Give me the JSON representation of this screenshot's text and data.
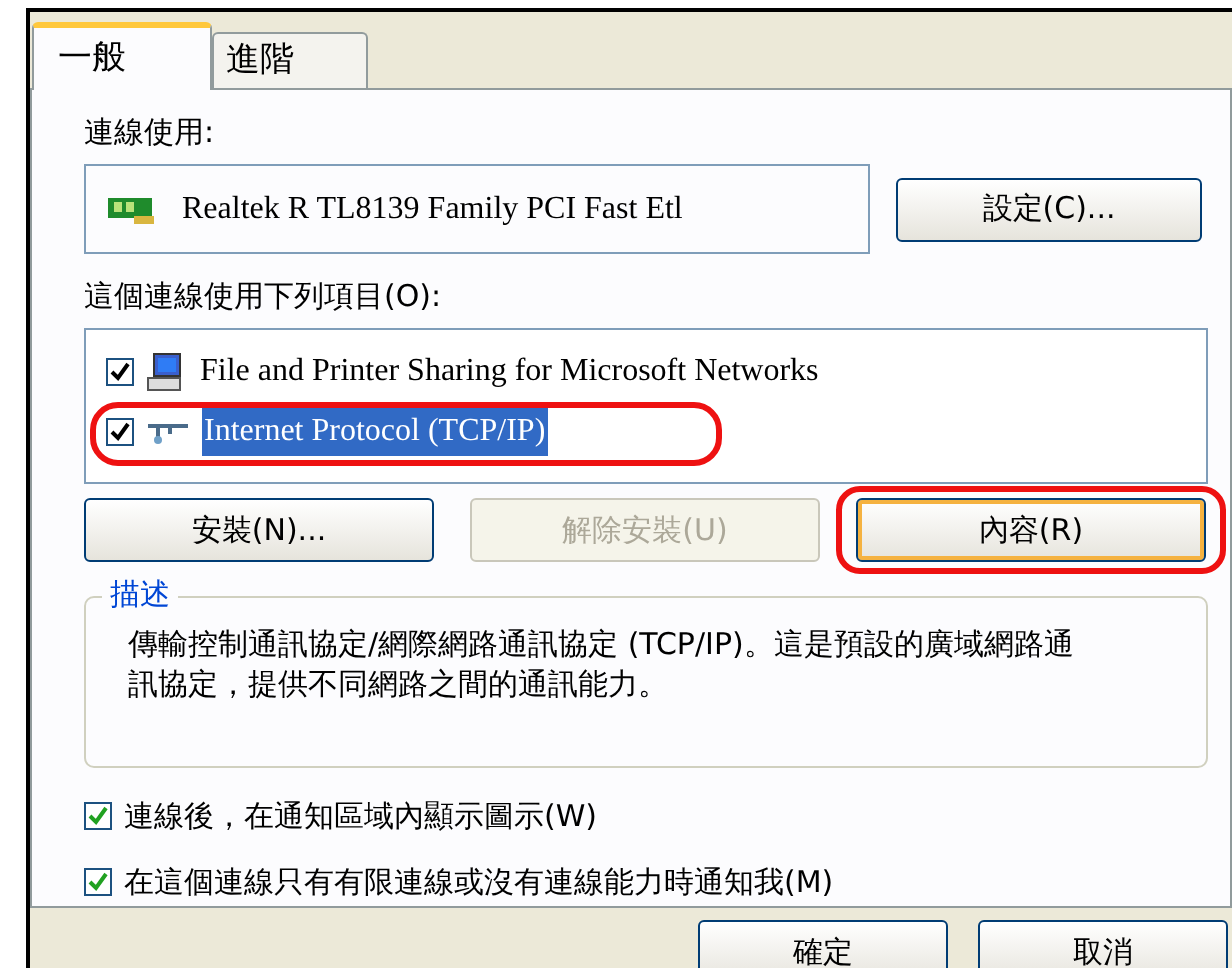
{
  "tabs": [
    {
      "label": "一般",
      "selected": true
    },
    {
      "label": "進階",
      "selected": false
    }
  ],
  "connect_using": {
    "label": "連線使用:",
    "adapter": "Realtek R TL8139 Family PCI Fast Etl",
    "configure_button": "設定(C)..."
  },
  "components": {
    "label": "這個連線使用下列項目(O):",
    "items": [
      {
        "label": "File and Printer Sharing for Microsoft Networks",
        "checked": true,
        "selected": false,
        "highlighted": false,
        "kind": "computer"
      },
      {
        "label": "Internet Protocol (TCP/IP)",
        "checked": true,
        "selected": true,
        "highlighted": true,
        "kind": "network"
      }
    ]
  },
  "buttons": [
    {
      "label": "安裝(N)...",
      "disabled": false,
      "focused": false,
      "highlighted": false
    },
    {
      "label": "解除安裝(U)",
      "disabled": true,
      "focused": false,
      "highlighted": false
    },
    {
      "label": "內容(R)",
      "disabled": false,
      "focused": true,
      "highlighted": true
    }
  ],
  "description": {
    "legend": "描述",
    "text": "傳輸控制通訊協定/網際網路通訊協定 (TCP/IP)。這是預設的廣域網路通訊協定，提供不同網路之間的通訊能力。"
  },
  "options": [
    {
      "label": "連線後，在通知區域內顯示圖示(W)",
      "checked": true
    },
    {
      "label": "在這個連線只有有限連線或沒有連線能力時通知我(M)",
      "checked": true
    }
  ],
  "dialog_buttons": [
    "確定",
    "取消"
  ]
}
